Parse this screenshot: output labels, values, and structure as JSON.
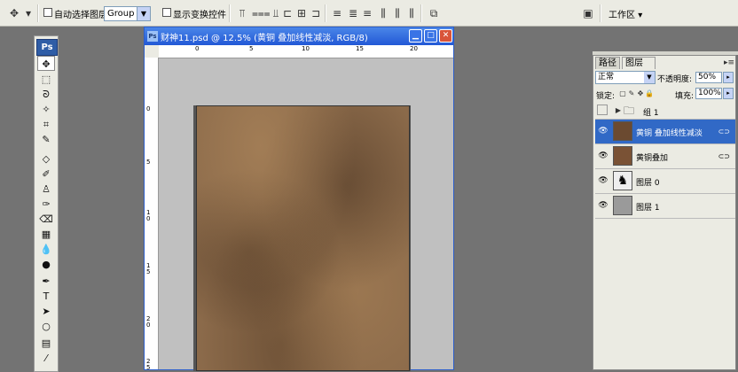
{
  "options_bar": {
    "auto_select_label": "自动选择图层",
    "auto_select_value": "Group",
    "show_transform_label": "显示变换控件",
    "workspace_label": "工作区"
  },
  "toolbox": {
    "logo": "Ps"
  },
  "document": {
    "title": "财神11.psd @ 12.5% (黄铜 叠加线性减淡, RGB/8)",
    "h_ruler": [
      "0",
      "5",
      "10",
      "15",
      "20"
    ],
    "v_ruler": [
      "0",
      "5",
      "1\n0",
      "1\n5",
      "2\n0",
      "2\n5"
    ]
  },
  "layers_panel": {
    "tabs": [
      "路径",
      "图层"
    ],
    "tab_close": "×",
    "blend_mode": "正常",
    "opacity_label": "不透明度:",
    "opacity_value": "50%",
    "lock_label": "锁定:",
    "fill_label": "填充:",
    "fill_value": "100%",
    "layers": [
      {
        "name": "组 1"
      },
      {
        "name": "黄铜 叠加线性减淡"
      },
      {
        "name": "黄铜叠加"
      },
      {
        "name": "图层 0"
      },
      {
        "name": "图层 1"
      }
    ]
  },
  "colors": {
    "title_bar": "#2258d6",
    "selected_layer": "#3169c6",
    "workspace_bg": "#737373"
  }
}
